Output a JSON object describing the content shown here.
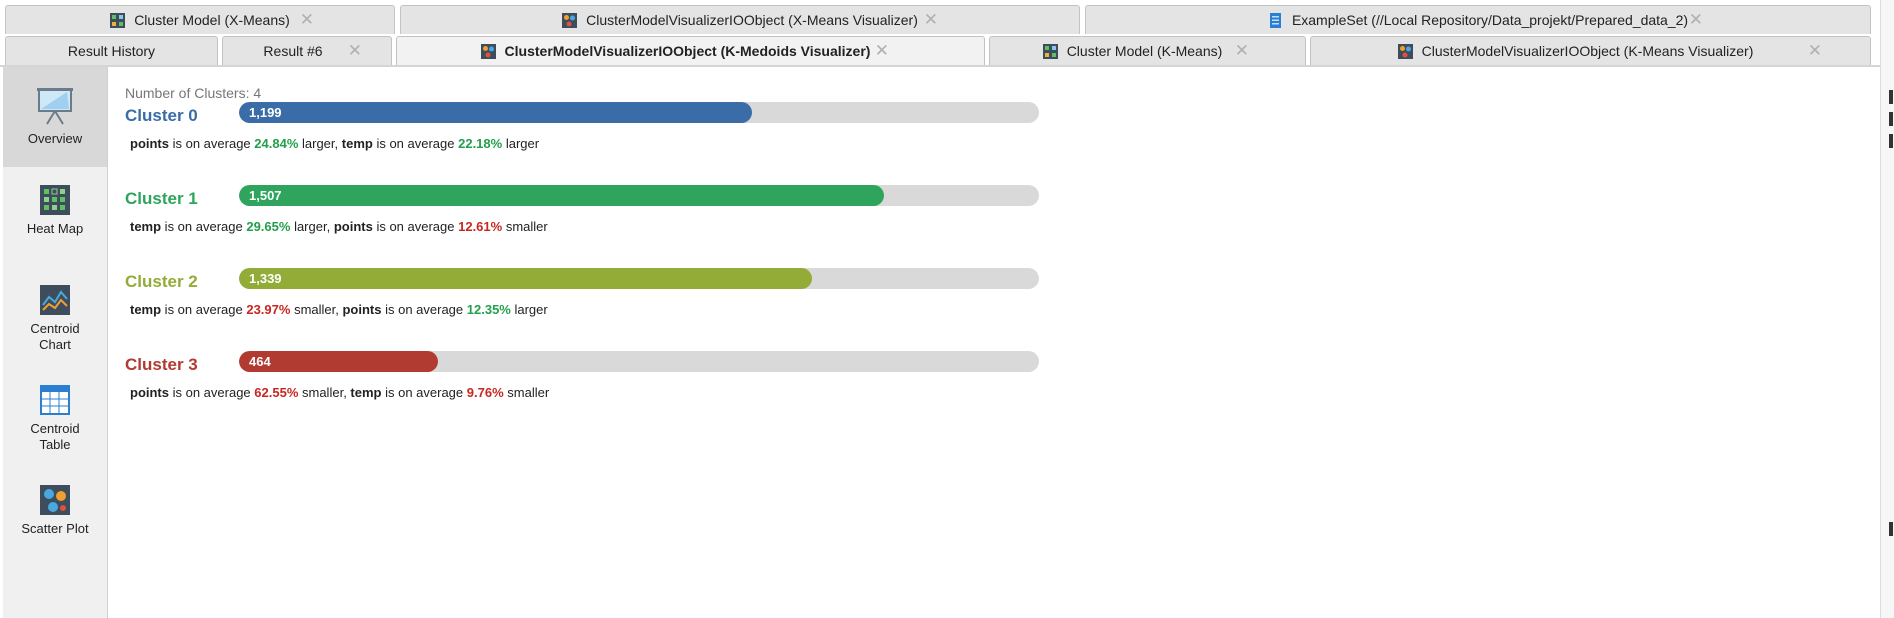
{
  "tabs_row1": [
    {
      "label": "Cluster Model (X-Means)",
      "icon": "cluster-model-icon"
    },
    {
      "label": "ClusterModelVisualizerIOObject (X-Means Visualizer)",
      "icon": "cluster-visualizer-icon"
    },
    {
      "label": "ExampleSet (//Local Repository/Data_projekt/Prepared_data_2)",
      "icon": "exampleset-icon"
    }
  ],
  "tabs_row2": [
    {
      "label": "Result History"
    },
    {
      "label": "Result #6"
    },
    {
      "label": "ClusterModelVisualizerIOObject (K-Medoids Visualizer)",
      "icon": "cluster-visualizer-icon",
      "active": true
    },
    {
      "label": "Cluster Model (K-Means)",
      "icon": "cluster-model-icon"
    },
    {
      "label": "ClusterModelVisualizerIOObject (K-Means Visualizer)",
      "icon": "cluster-visualizer-icon"
    }
  ],
  "close_glyph": "✕",
  "sidebar": [
    {
      "label": "Overview",
      "icon": "presentation-board-icon",
      "active": true
    },
    {
      "label": "Heat Map",
      "icon": "heat-map-icon"
    },
    {
      "label": "Centroid Chart",
      "icon": "centroid-chart-icon"
    },
    {
      "label": "Centroid Table",
      "icon": "centroid-table-icon"
    },
    {
      "label": "Scatter Plot",
      "icon": "scatter-plot-icon"
    }
  ],
  "main": {
    "num_clusters_label": "Number of Clusters: 4",
    "bar_max": 1870,
    "clusters": [
      {
        "name": "Cluster 0",
        "count": 1199,
        "count_label": "1,199",
        "color": "#3a6ca8",
        "desc": [
          {
            "attr": "points",
            "mid": " is on average ",
            "pct": "24.84%",
            "dir": "larger",
            "sep": ", "
          },
          {
            "attr": "temp",
            "mid": " is on average ",
            "pct": "22.18%",
            "dir": "larger",
            "sep": ""
          }
        ]
      },
      {
        "name": "Cluster 1",
        "count": 1507,
        "count_label": "1,507",
        "color": "#2fa45c",
        "desc": [
          {
            "attr": "temp",
            "mid": " is on average ",
            "pct": "29.65%",
            "dir": "larger",
            "sep": ", "
          },
          {
            "attr": "points",
            "mid": " is on average ",
            "pct": "12.61%",
            "dir": "smaller",
            "sep": ""
          }
        ]
      },
      {
        "name": "Cluster 2",
        "count": 1339,
        "count_label": "1,339",
        "color": "#93ab37",
        "desc": [
          {
            "attr": "temp",
            "mid": " is on average ",
            "pct": "23.97%",
            "dir": "smaller",
            "sep": ", "
          },
          {
            "attr": "points",
            "mid": " is on average ",
            "pct": "12.35%",
            "dir": "larger",
            "sep": ""
          }
        ]
      },
      {
        "name": "Cluster 3",
        "count": 464,
        "count_label": "464",
        "color": "#b13b30",
        "desc": [
          {
            "attr": "points",
            "mid": " is on average ",
            "pct": "62.55%",
            "dir": "smaller",
            "sep": ", "
          },
          {
            "attr": "temp",
            "mid": " is on average ",
            "pct": "9.76%",
            "dir": "smaller",
            "sep": ""
          }
        ]
      }
    ]
  }
}
